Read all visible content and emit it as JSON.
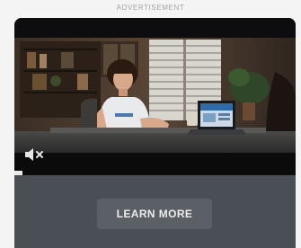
{
  "header": {
    "label": "ADVERTISEMENT"
  },
  "video": {
    "progress_fraction": 0.03,
    "mute_icon": "speaker-muted-icon",
    "thumbnail": "Woman at a desk with a laptop"
  },
  "cta": {
    "label": "LEARN MORE"
  },
  "colors": {
    "page_bg": "#f4f4f4",
    "card_bg": "#2a2d31",
    "cta_panel": "#4a4f55",
    "cta_button": "#5b6066",
    "progress": "#e9e9e9"
  }
}
